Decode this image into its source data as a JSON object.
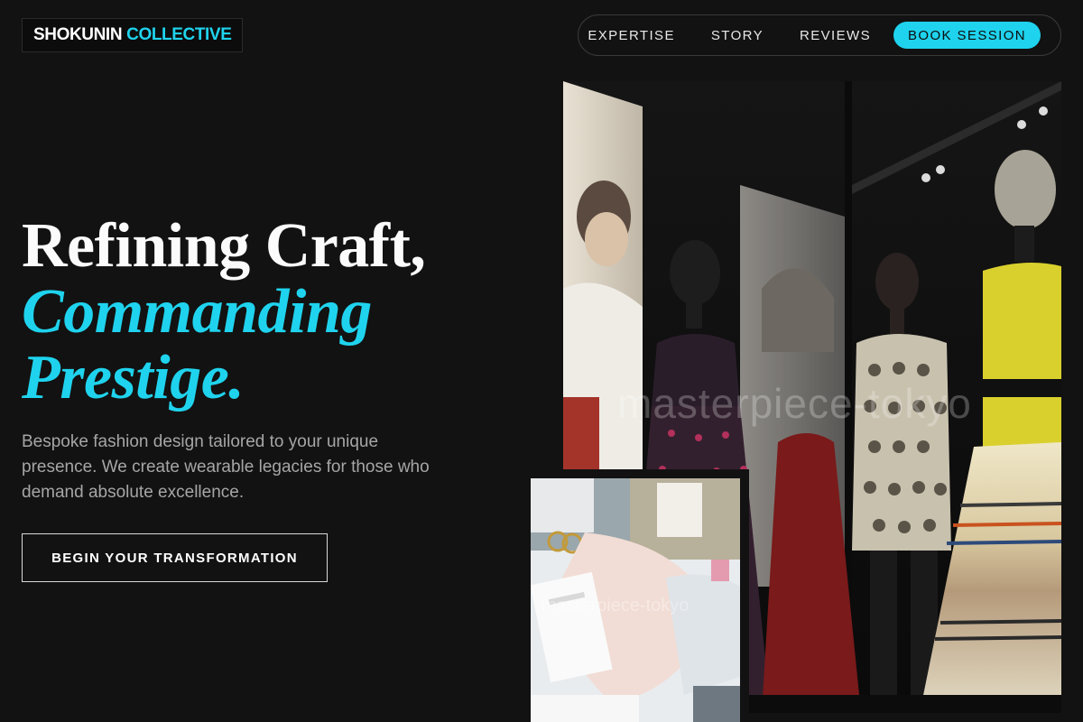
{
  "brand": {
    "name_primary": "SHOKUNIN",
    "name_accent": "COLLECTIVE"
  },
  "nav": {
    "items": [
      {
        "label": "EXPERTISE"
      },
      {
        "label": "STORY"
      },
      {
        "label": "REVIEWS"
      }
    ],
    "cta_label": "BOOK SESSION"
  },
  "hero": {
    "headline_line1": "Refining Craft,",
    "headline_line2": "Commanding",
    "headline_line3": "Prestige.",
    "subtitle": "Bespoke fashion design tailored to your unique presence. We create wearable legacies for those who demand absolute excellence.",
    "cta_label": "BEGIN YOUR TRANSFORMATION"
  },
  "gallery": {
    "main_watermark": "masterpiece-tokyo",
    "inset_watermark": "masterpiece-tokyo"
  },
  "colors": {
    "background": "#121212",
    "accent": "#1fd3ee",
    "text_primary": "#ffffff",
    "text_muted": "#a6a6a6"
  }
}
